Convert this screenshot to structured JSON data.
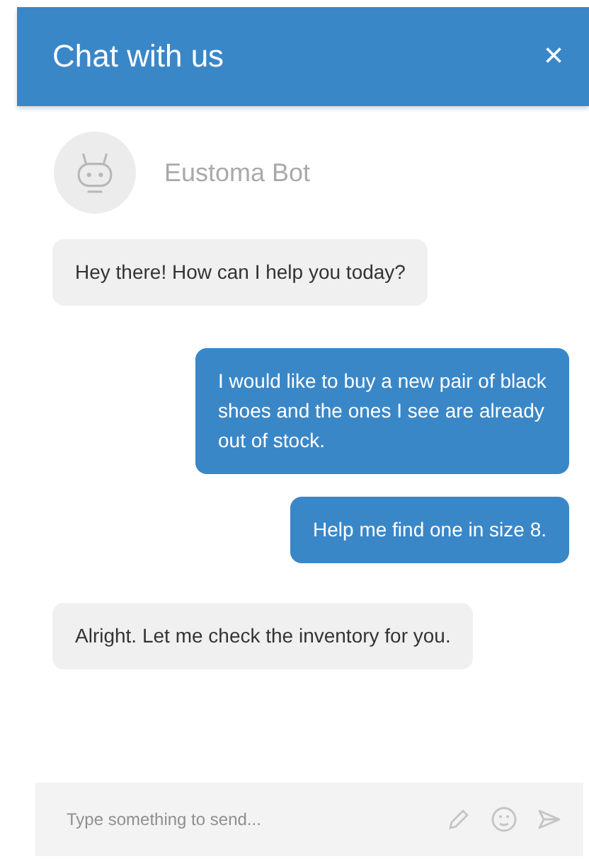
{
  "header": {
    "title": "Chat with us",
    "close": "×"
  },
  "agent": {
    "name": "Eustoma Bot"
  },
  "messages": [
    {
      "kind": "bot",
      "text": "Hey there! How can I help you today?"
    },
    {
      "kind": "user",
      "text": "I would like to buy a new pair of black shoes and the ones I see are already out of stock."
    },
    {
      "kind": "user",
      "text": "Help me find one in size 8."
    },
    {
      "kind": "bot",
      "text": "Alright. Let me check the inventory for you."
    }
  ],
  "composer": {
    "placeholder": "Type something to send..."
  }
}
